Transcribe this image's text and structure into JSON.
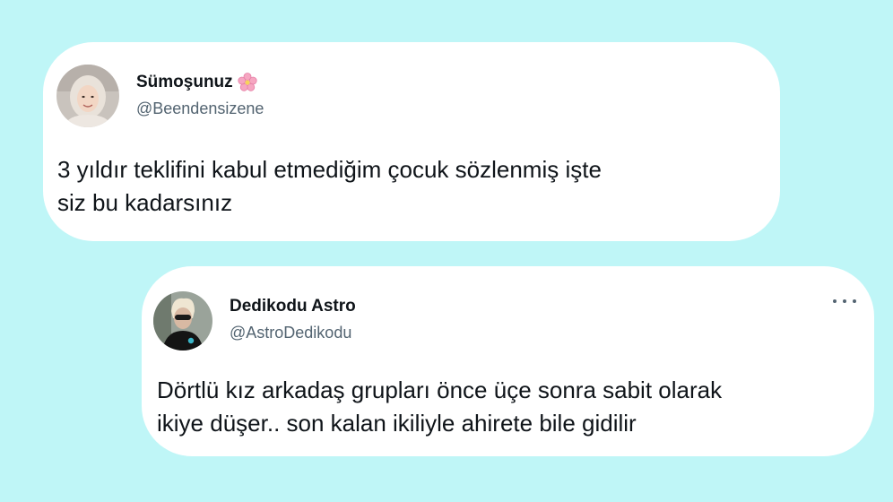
{
  "colors": {
    "background": "#bff6f7",
    "card": "#ffffff",
    "text": "#0f1419",
    "handle": "#536471"
  },
  "tweets": [
    {
      "name": "Sümoşunuz",
      "name_emoji_icon": "cherry-blossom-icon",
      "handle": "@Beendensizene",
      "text_lines": [
        "3 yıldır teklifini kabul etmediğim çocuk sözlenmiş işte",
        "siz bu kadarsınız"
      ]
    },
    {
      "name": "Dedikodu Astro",
      "handle": "@AstroDedikodu",
      "more_icon": "more-options-icon",
      "text_lines": [
        "Dörtlü kız arkadaş grupları önce üçe sonra sabit olarak",
        "ikiye düşer.. son kalan ikiliyle ahirete bile gidilir"
      ]
    }
  ]
}
